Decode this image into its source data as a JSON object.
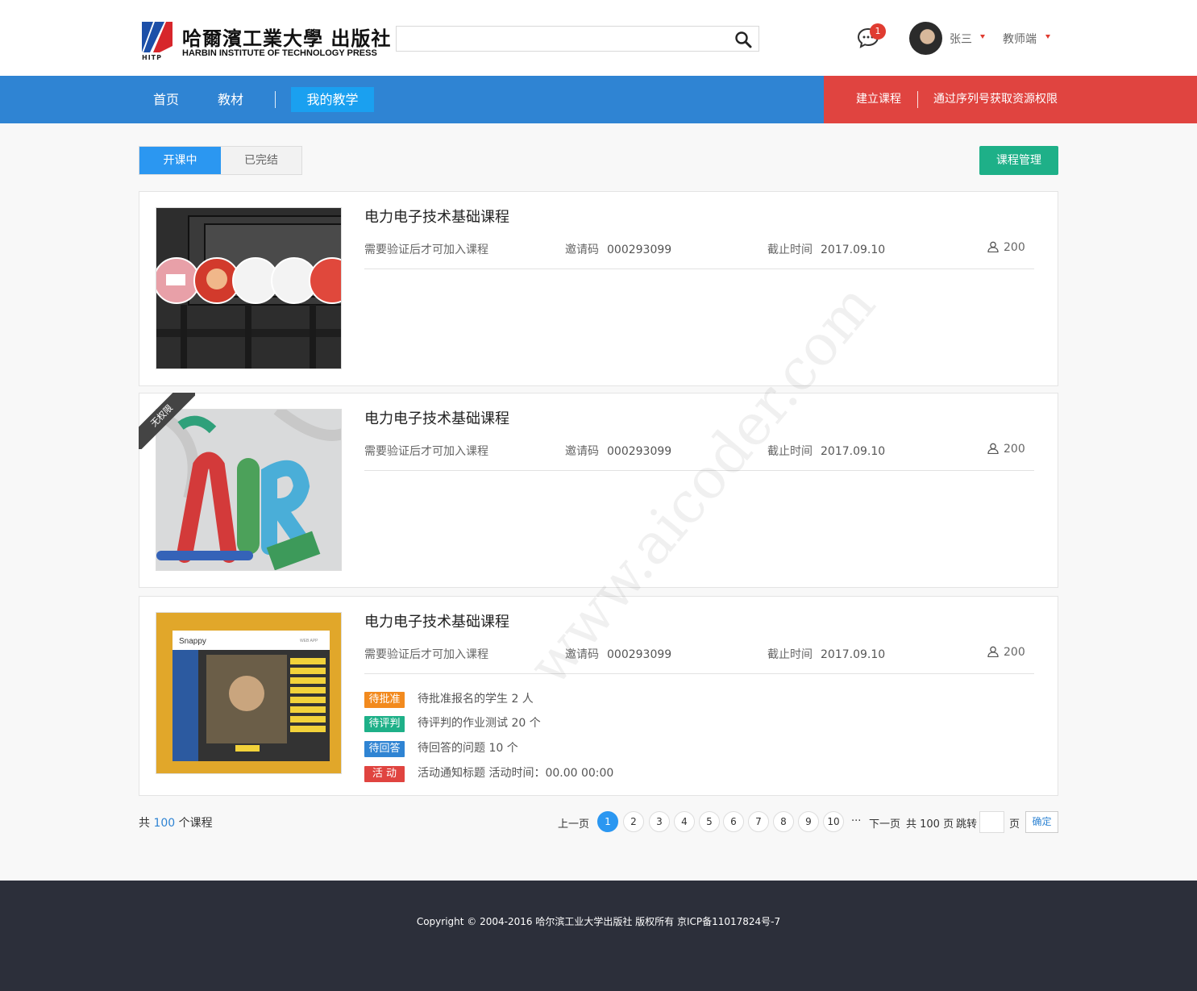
{
  "header": {
    "logo_title": "哈爾濱工業大學 出版社",
    "logo_subtitle": "HARBIN INSTITUTE OF TECHNOLOGY PRESS",
    "logo_mark": "HITP",
    "search_placeholder": "",
    "message_count": "1",
    "user_name": "张三",
    "role": "教师端"
  },
  "nav": {
    "items": [
      "首页",
      "教材",
      "我的教学"
    ],
    "right_items": [
      "建立课程",
      "通过序列号获取资源权限"
    ],
    "colors": {
      "main": "#2f84d3",
      "active": "#1aa0f0",
      "right": "#e04440"
    }
  },
  "tabs": [
    "开课中",
    "已完结"
  ],
  "manage_button": "课程管理",
  "courses": [
    {
      "title": "电力电子技术基础课程",
      "requirement": "需要验证后才可加入课程",
      "invite_label": "邀请码",
      "invite_code": "000293099",
      "deadline_label": "截止时间",
      "deadline": "2017.09.10",
      "students": "200",
      "image": "conveyor-illustration"
    },
    {
      "title": "电力电子技术基础课程",
      "requirement": "需要验证后才可加入课程",
      "invite_label": "邀请码",
      "invite_code": "000293099",
      "deadline_label": "截止时间",
      "deadline": "2017.09.10",
      "students": "200",
      "ribbon": "无权限",
      "image": "air-balloon-letters"
    },
    {
      "title": "电力电子技术基础课程",
      "requirement": "需要验证后才可加入课程",
      "invite_label": "邀请码",
      "invite_code": "000293099",
      "deadline_label": "截止时间",
      "deadline": "2017.09.10",
      "students": "200",
      "image": "snappy-web-app",
      "image_text": {
        "app": "Snappy",
        "badge": "WEB APP"
      },
      "tasks": [
        {
          "tag": "待批准",
          "color": "#f28a1e",
          "text": "待批准报名的学生 2 人"
        },
        {
          "tag": "待评判",
          "color": "#1eb088",
          "text": "待评判的作业测试 20 个"
        },
        {
          "tag": "待回答",
          "color": "#2f84d3",
          "text": "待回答的问题 10 个"
        },
        {
          "tag": "活 动",
          "color": "#e04440",
          "text": "活动通知标题  活动时间：00.00 00:00"
        }
      ]
    }
  ],
  "pagination": {
    "total_prefix": "共",
    "total": "100",
    "total_suffix": "个课程",
    "prev": "上一页",
    "pages": [
      "1",
      "2",
      "3",
      "4",
      "5",
      "6",
      "7",
      "8",
      "9",
      "10"
    ],
    "current": "1",
    "ellipsis": "···",
    "next": "下一页",
    "page_count": "共 100 页",
    "jump_label": "跳转",
    "page_unit": "页",
    "confirm": "确定"
  },
  "footer": {
    "copyright": "Copyright © 2004-2016 哈尔滨工业大学出版社  版权所有    京ICP备11017824号-7"
  },
  "watermark": "www.aicoder.com"
}
